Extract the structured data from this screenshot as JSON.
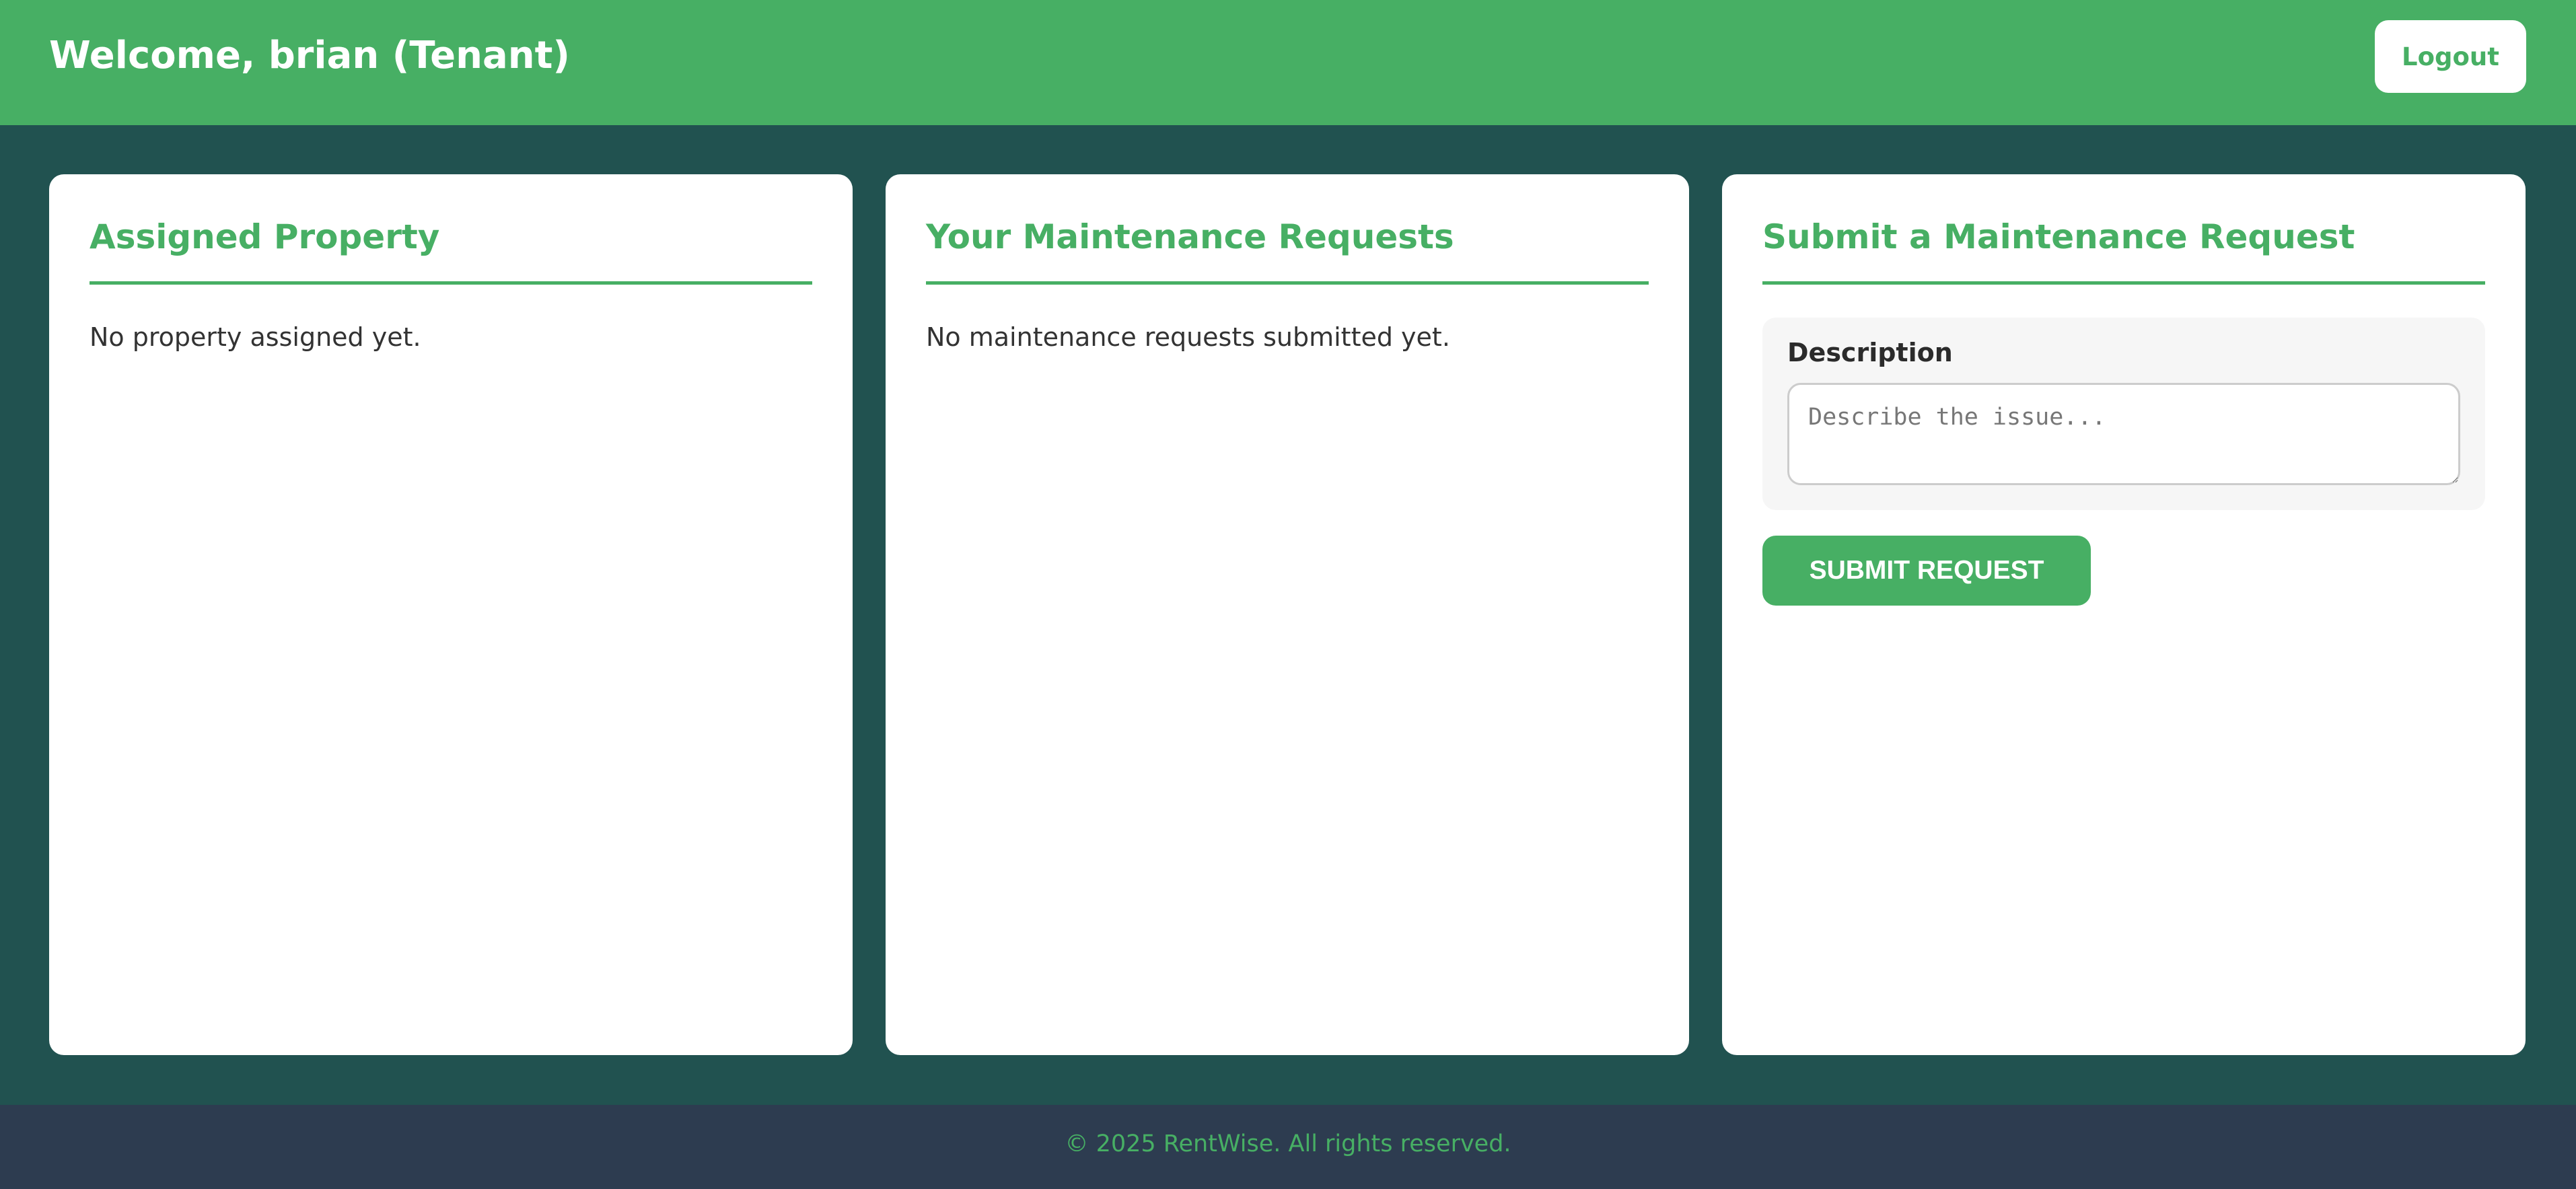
{
  "header": {
    "title": "Welcome, brian (Tenant)",
    "logout_label": "Logout"
  },
  "property_card": {
    "title": "Assigned Property",
    "empty_text": "No property assigned yet."
  },
  "requests_card": {
    "title": "Your Maintenance Requests",
    "empty_text": "No maintenance requests submitted yet."
  },
  "submit_card": {
    "title": "Submit a Maintenance Request",
    "description_label": "Description",
    "description_placeholder": "Describe the issue...",
    "description_value": "",
    "submit_label": "SUBMIT REQUEST"
  },
  "footer": {
    "text": "© 2025 RentWise. All rights reserved."
  },
  "colors": {
    "brand_green": "#47af64",
    "background_teal": "#215250",
    "footer_navy": "#2d3c50"
  }
}
